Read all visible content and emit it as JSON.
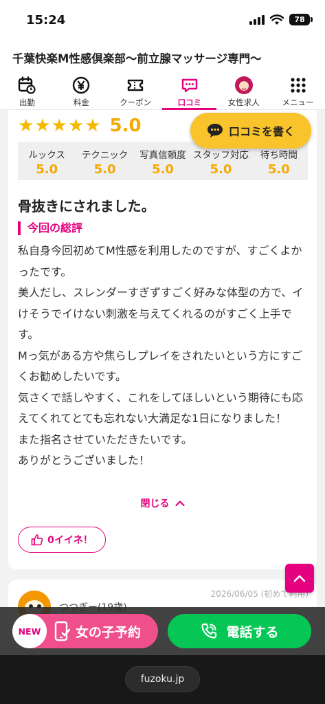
{
  "status_bar": {
    "time": "15:24",
    "battery": "78"
  },
  "header": {
    "shop_title": "千葉快楽M性感倶楽部〜前立腺マッサージ専門〜",
    "nav": [
      {
        "label": "出勤",
        "icon": "calendar-icon",
        "active": false
      },
      {
        "label": "料金",
        "icon": "yen-icon",
        "active": false
      },
      {
        "label": "クーポン",
        "icon": "coupon-icon",
        "active": false
      },
      {
        "label": "口コミ",
        "icon": "chat-icon",
        "active": true
      },
      {
        "label": "女性求人",
        "icon": "avatar-icon",
        "active": false
      },
      {
        "label": "メニュー",
        "icon": "grid-menu-icon",
        "active": false
      }
    ]
  },
  "review": {
    "stars": "★★★★★",
    "overall": "5.0",
    "write_button": "口コミを書く",
    "scores": [
      {
        "label": "ルックス",
        "value": "5.0"
      },
      {
        "label": "テクニック",
        "value": "5.0"
      },
      {
        "label": "写真信頼度",
        "value": "5.0"
      },
      {
        "label": "スタッフ対応",
        "value": "5.0"
      },
      {
        "label": "待ち時間",
        "value": "5.0"
      }
    ],
    "title": "骨抜きにされました。",
    "section_label": "今回の総評",
    "paragraphs": [
      "私自身今回初めてM性感を利用したのですが、すごくよかったです。",
      "美人だし、スレンダーすぎずすごく好みな体型の方で、イけそうでイけない刺激を与えてくれるのがすごく上手です。",
      "Mっ気がある方や焦らしプレイをされたいという方にすごくお勧めしたいです。",
      "気さくで話しやすく、これをしてほしいという期待にも応えてくれてとても忘れない大満足な1日になりました！",
      "また指名させていただきたいです。",
      "ありがとうございました！"
    ],
    "close_label": "閉じる",
    "like_label": "0イイネ！"
  },
  "next_review": {
    "date": "2026/06/05 (初めて利用)",
    "reviewer": "つつぎー(19歳)"
  },
  "cta": {
    "new_badge": "NEW",
    "reserve_label": "女の子予約",
    "call_label": "電話する"
  },
  "browser": {
    "url": "fuzoku.jp"
  },
  "colors": {
    "accent": "#e4007f",
    "star": "#f5b800",
    "call": "#06c755",
    "write": "#f9c42b"
  }
}
